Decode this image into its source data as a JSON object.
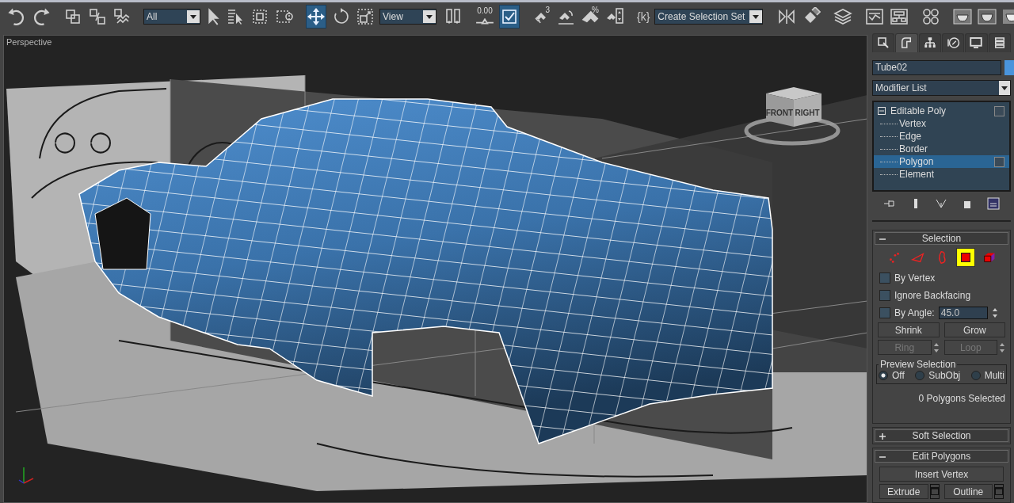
{
  "toolbar": {
    "items": [
      {
        "kind": "undo",
        "active": false
      },
      {
        "kind": "redo",
        "active": false
      },
      {
        "kind": "sep"
      },
      {
        "kind": "link",
        "active": false
      },
      {
        "kind": "unlink",
        "active": false
      },
      {
        "kind": "bind",
        "active": false
      },
      {
        "kind": "sep"
      },
      {
        "kind": "dropdown",
        "value": "All"
      },
      {
        "kind": "select",
        "active": false
      },
      {
        "kind": "select-by-name",
        "active": false
      },
      {
        "kind": "region",
        "active": false
      },
      {
        "kind": "window-crossing",
        "active": false
      },
      {
        "kind": "sep"
      },
      {
        "kind": "move",
        "active": true
      },
      {
        "kind": "rotate",
        "active": false
      },
      {
        "kind": "scale",
        "active": false
      },
      {
        "kind": "dropdown",
        "value": "View"
      },
      {
        "kind": "pivot",
        "active": false
      },
      {
        "kind": "sep"
      },
      {
        "kind": "spinner-snap",
        "label": "0.00",
        "active": false
      },
      {
        "kind": "toggle",
        "active": true
      },
      {
        "kind": "sep"
      },
      {
        "kind": "snap",
        "label": "3",
        "active": false
      },
      {
        "kind": "angle-snap",
        "active": false
      },
      {
        "kind": "percent-snap",
        "label": "%",
        "active": false
      },
      {
        "kind": "spinner-toggle",
        "active": false
      },
      {
        "kind": "sep"
      },
      {
        "kind": "named-selection",
        "label": "{k}",
        "active": false
      },
      {
        "kind": "dropdown",
        "value": "Create Selection Set"
      },
      {
        "kind": "sep"
      },
      {
        "kind": "mirror",
        "active": false
      },
      {
        "kind": "align",
        "active": false
      },
      {
        "kind": "sep"
      },
      {
        "kind": "layers",
        "active": false
      },
      {
        "kind": "sep"
      },
      {
        "kind": "curve-editor",
        "active": false
      },
      {
        "kind": "schematic",
        "active": false
      },
      {
        "kind": "sep"
      },
      {
        "kind": "material",
        "active": false
      },
      {
        "kind": "sep"
      },
      {
        "kind": "render-setup",
        "active": false
      },
      {
        "kind": "render-frame",
        "active": false
      },
      {
        "kind": "render",
        "active": false
      }
    ]
  },
  "viewport": {
    "label": "Perspective",
    "viewcube": {
      "front": "FRONT",
      "right": "RIGHT"
    }
  },
  "command_panel": {
    "tabs": [
      {
        "kind": "create",
        "selected": false
      },
      {
        "kind": "modify",
        "selected": true
      },
      {
        "kind": "hierarchy",
        "selected": false
      },
      {
        "kind": "motion",
        "selected": false
      },
      {
        "kind": "display",
        "selected": false
      },
      {
        "kind": "utilities",
        "selected": false
      }
    ],
    "object_name": "Tube02",
    "modifier_list": "Modifier List",
    "stack": [
      {
        "label": "Editable Poly",
        "expanded": true,
        "selected": false,
        "children": [
          {
            "label": "Vertex",
            "selected": false
          },
          {
            "label": "Edge",
            "selected": false
          },
          {
            "label": "Border",
            "selected": false
          },
          {
            "label": "Polygon",
            "selected": true
          },
          {
            "label": "Element",
            "selected": false
          }
        ]
      }
    ],
    "rollouts": [
      {
        "kind": "selection",
        "title": "Selection",
        "expanded": true,
        "levels": [
          {
            "kind": "vertex",
            "selected": false
          },
          {
            "kind": "edge",
            "selected": false
          },
          {
            "kind": "border",
            "selected": false
          },
          {
            "kind": "polygon",
            "selected": true
          },
          {
            "kind": "element",
            "selected": false
          }
        ],
        "checkboxes": [
          {
            "label": "By Vertex",
            "checked": false
          },
          {
            "label": "Ignore Backfacing",
            "checked": false
          },
          {
            "label": "By Angle:",
            "checked": false,
            "value": "45.0"
          }
        ],
        "buttons": [
          {
            "label": "Shrink",
            "disabled": false
          },
          {
            "label": "Grow",
            "disabled": false
          },
          {
            "label": "Ring",
            "disabled": true
          },
          {
            "label": "Loop",
            "disabled": true
          }
        ],
        "preview": {
          "title": "Preview Selection",
          "options": [
            {
              "label": "Off",
              "selected": true
            },
            {
              "label": "SubObj",
              "selected": false
            },
            {
              "label": "Multi",
              "selected": false
            }
          ]
        },
        "status": "0 Polygons Selected"
      },
      {
        "title": "Soft Selection",
        "expanded": false
      },
      {
        "kind": "edit",
        "title": "Edit Polygons",
        "expanded": true,
        "buttons": [
          {
            "label": "Insert Vertex",
            "settings": false
          },
          {
            "label": "Extrude",
            "settings": true
          },
          {
            "label": "Outline",
            "settings": true
          }
        ]
      }
    ]
  }
}
